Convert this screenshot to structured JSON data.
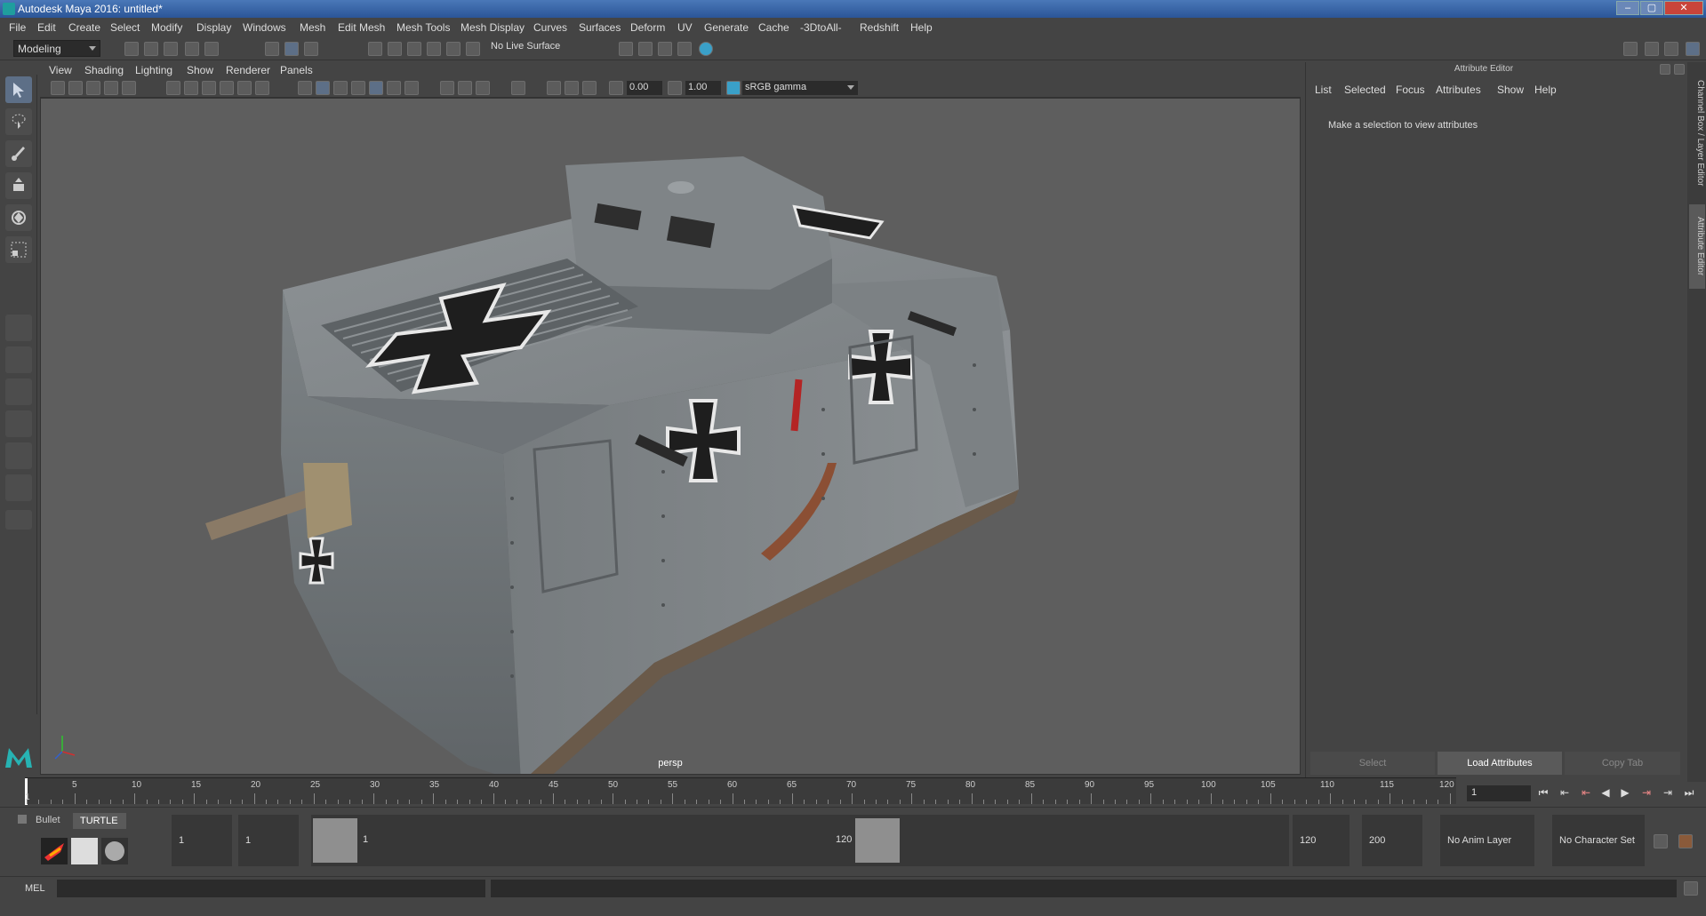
{
  "title_bar": {
    "title": "Autodesk Maya 2016: untitled*"
  },
  "menu": {
    "items": [
      "File",
      "Edit",
      "Create",
      "Select",
      "Modify",
      "Display",
      "Windows",
      "Mesh",
      "Edit Mesh",
      "Mesh Tools",
      "Mesh Display",
      "Curves",
      "Surfaces",
      "Deform",
      "UV",
      "Generate",
      "Cache",
      "-3DtoAll-",
      "Redshift",
      "Help"
    ]
  },
  "shelf": {
    "mode": "Modeling",
    "live_surface": "No Live Surface"
  },
  "panel": {
    "menu": [
      "View",
      "Shading",
      "Lighting",
      "Show",
      "Renderer",
      "Panels"
    ],
    "exposure": "0.00",
    "gamma": "1.00",
    "color_space": "sRGB gamma",
    "camera": "persp"
  },
  "attribute_editor": {
    "title": "Attribute Editor",
    "menu": [
      "List",
      "Selected",
      "Focus",
      "Attributes",
      "Show",
      "Help"
    ],
    "message": "Make a selection to view attributes",
    "buttons": {
      "select": "Select",
      "load": "Load Attributes",
      "copy": "Copy Tab"
    }
  },
  "side_tabs": {
    "channel_box": "Channel Box / Layer Editor",
    "attribute_editor": "Attribute Editor"
  },
  "timeline": {
    "ticks": [
      "1",
      "5",
      "10",
      "15",
      "20",
      "25",
      "30",
      "35",
      "40",
      "45",
      "50",
      "55",
      "60",
      "65",
      "70",
      "75",
      "80",
      "85",
      "90",
      "95",
      "100",
      "105",
      "110",
      "115",
      "120"
    ],
    "current_frame": "1"
  },
  "range": {
    "start": "1",
    "playback_start": "1",
    "slider_start": "1",
    "slider_end": "120",
    "playback_end": "120",
    "end": "200",
    "anim_layer": "No Anim Layer",
    "character_set": "No Character Set"
  },
  "shelf_tabs": {
    "bullet": "Bullet",
    "turtle": "TURTLE"
  },
  "mel": {
    "label": "MEL"
  }
}
